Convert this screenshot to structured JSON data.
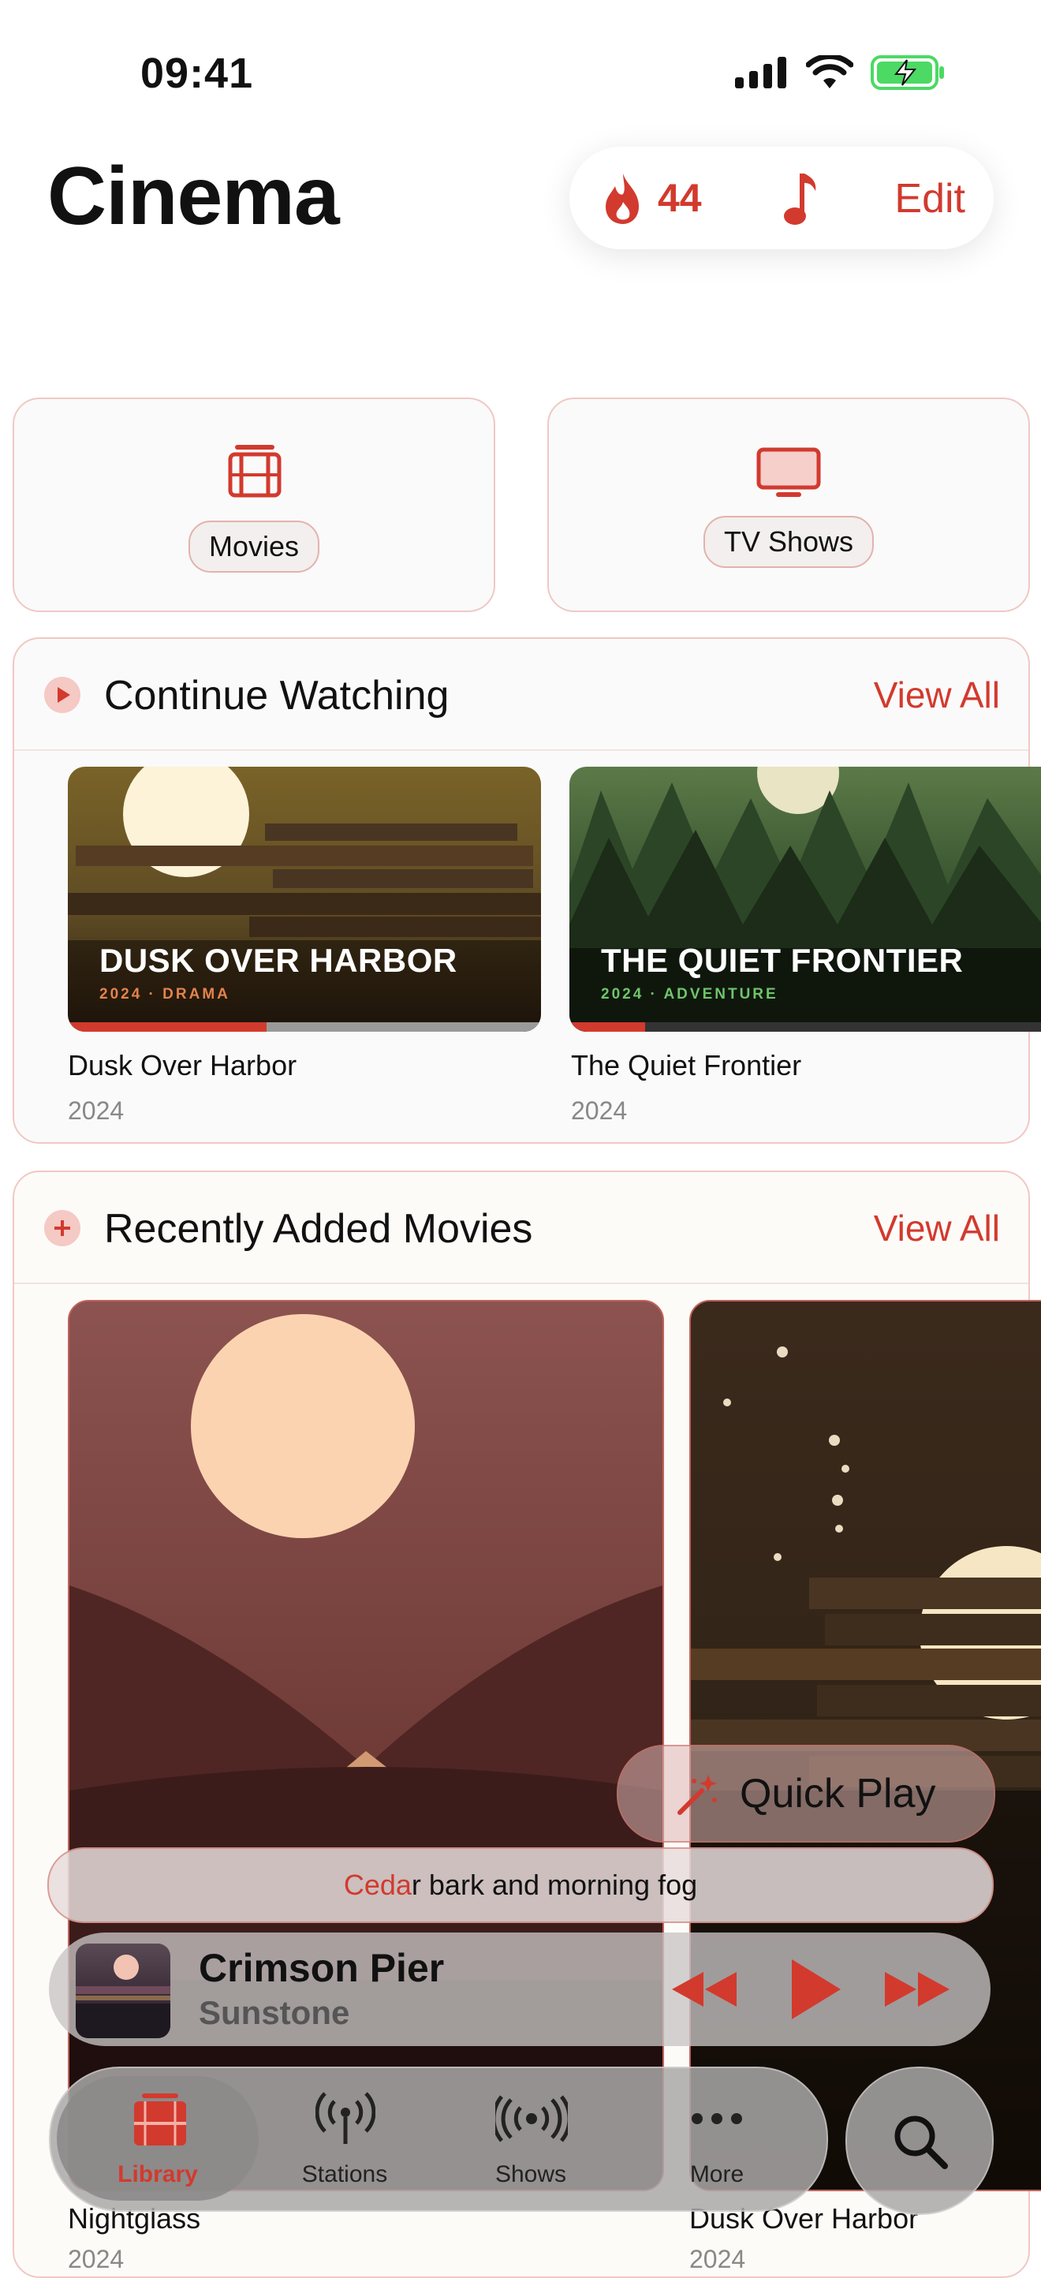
{
  "status": {
    "time": "09:41"
  },
  "header": {
    "title": "Cinema",
    "streak_count": "44",
    "edit_label": "Edit"
  },
  "categories": [
    {
      "label": "Movies"
    },
    {
      "label": "TV Shows"
    }
  ],
  "continue_watching": {
    "title": "Continue Watching",
    "view_all": "View All",
    "items": [
      {
        "title": "Dusk Over Harbor",
        "year": "2024",
        "poster_title": "DUSK OVER HARBOR",
        "poster_meta": "2024 · DRAMA",
        "progress": 0.42
      },
      {
        "title": "The Quiet Frontier",
        "year": "2024",
        "poster_title": "THE QUIET FRONTIER",
        "poster_meta": "2024 · ADVENTURE",
        "progress": 0.16
      }
    ]
  },
  "recently_added": {
    "title": "Recently Added Movies",
    "view_all": "View All",
    "items": [
      {
        "title": "Nightglass",
        "year": "2024"
      },
      {
        "title": "Dusk Over Harbor",
        "year": "2024"
      }
    ]
  },
  "quick_play": {
    "label": "Quick Play"
  },
  "lyric": {
    "highlighted": "Ceda",
    "rest": "r bark and morning fog"
  },
  "now_playing": {
    "title": "Crimson Pier",
    "artist": "Sunstone"
  },
  "tabs": [
    {
      "label": "Library",
      "active": true
    },
    {
      "label": "Stations"
    },
    {
      "label": "Shows"
    },
    {
      "label": "More"
    }
  ],
  "colors": {
    "accent": "#d23a2e"
  }
}
